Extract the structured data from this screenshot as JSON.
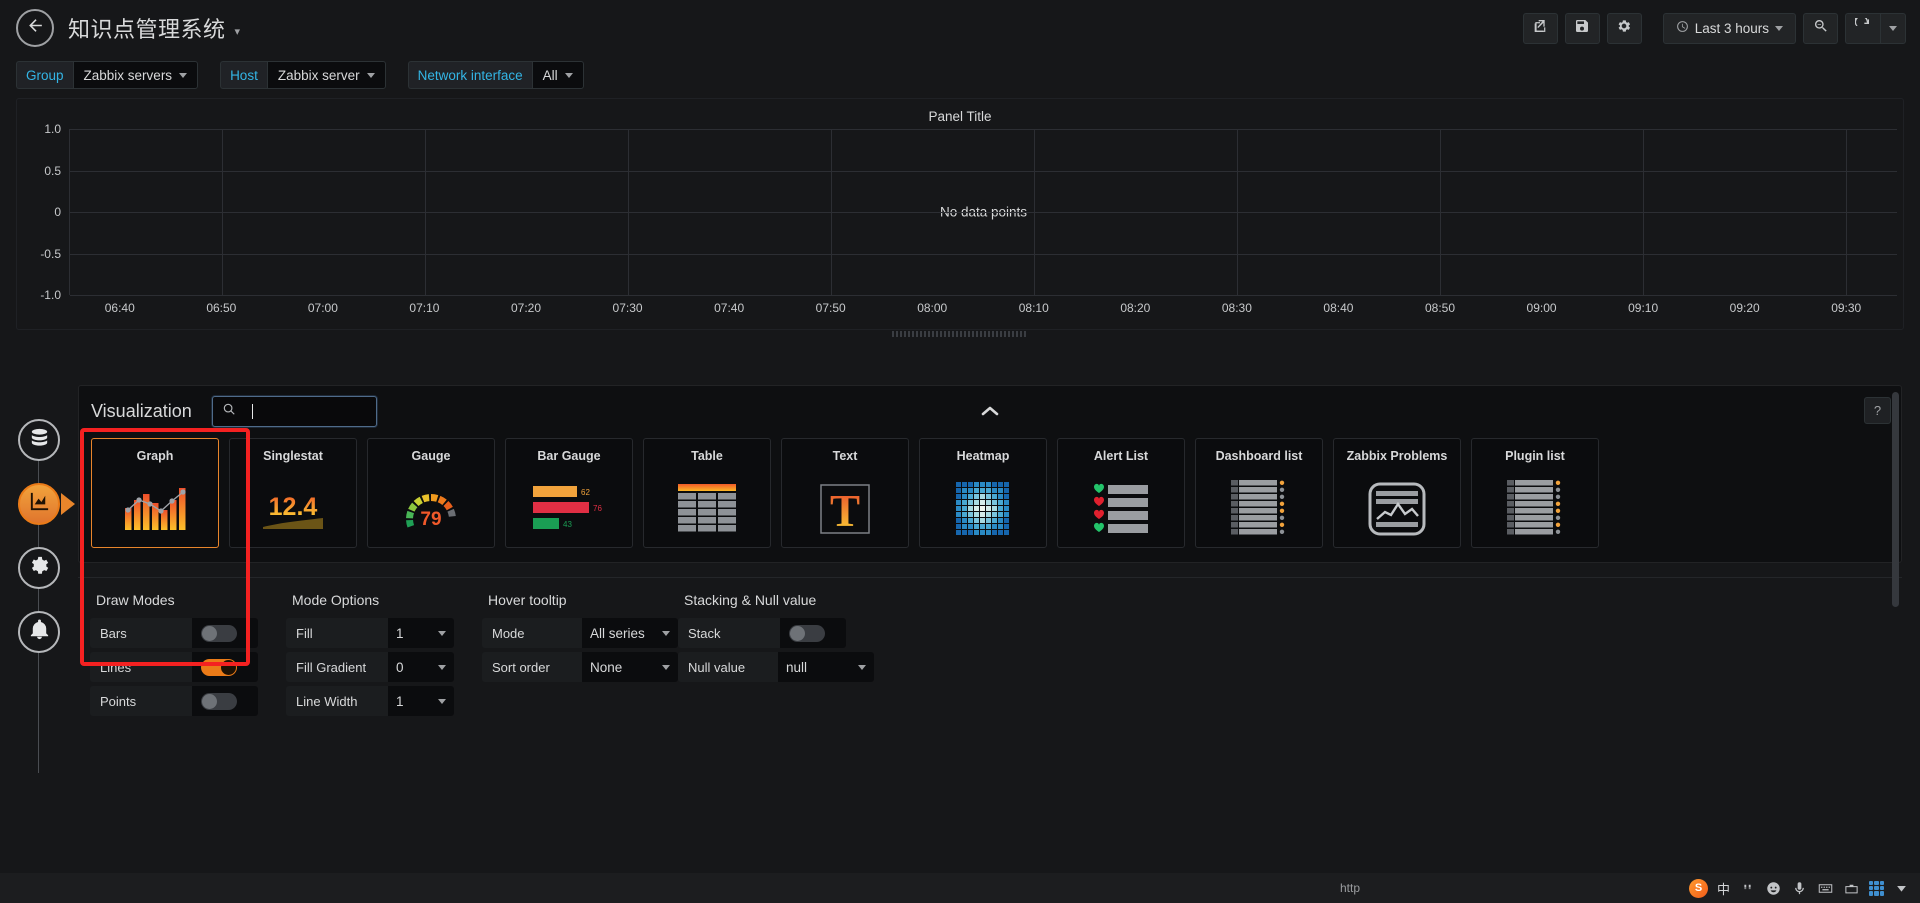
{
  "topnav": {
    "back_icon": "back-arrow-icon",
    "title": "知识点管理系统",
    "title_caret": "▾",
    "buttons": [
      {
        "name": "share-dashboard-button",
        "icon": "share-icon"
      },
      {
        "name": "save-dashboard-button",
        "icon": "save-icon"
      },
      {
        "name": "dashboard-settings-button",
        "icon": "gear-icon"
      }
    ],
    "time_picker": {
      "label": "Last 3 hours",
      "icon": "clock-icon"
    },
    "zoom_out": {
      "name": "zoom-out-button",
      "icon": "search-minus-icon"
    },
    "refresh": {
      "name": "refresh-button",
      "icon": "refresh-icon"
    },
    "refresh_interval_caret": "▾"
  },
  "submenu": {
    "variables": [
      {
        "label": "Group",
        "value": "Zabbix servers"
      },
      {
        "label": "Host",
        "value": "Zabbix server"
      },
      {
        "label": "Network interface",
        "value": "All"
      }
    ]
  },
  "panel": {
    "title": "Panel Title",
    "no_data_text": "No data points"
  },
  "chart_data": {
    "type": "line",
    "title": "Panel Title",
    "xlabel": "",
    "ylabel": "",
    "series": [],
    "values": [],
    "y_ticks": [
      "1.0",
      "0.5",
      "0",
      "-0.5",
      "-1.0"
    ],
    "ylim": [
      -1.0,
      1.0
    ],
    "x_ticks": [
      "06:40",
      "06:50",
      "07:00",
      "07:10",
      "07:20",
      "07:30",
      "07:40",
      "07:50",
      "08:00",
      "08:10",
      "08:20",
      "08:30",
      "08:40",
      "08:50",
      "09:00",
      "09:10",
      "09:20",
      "09:30"
    ],
    "grid": true,
    "legend": "none",
    "empty_message": "No data points"
  },
  "rail": {
    "items": [
      {
        "name": "sidebar-item-queries",
        "icon": "database-icon",
        "active": false
      },
      {
        "name": "sidebar-item-visualization",
        "icon": "graph-area-icon",
        "active": true
      },
      {
        "name": "sidebar-item-general",
        "icon": "gear-wrench-icon",
        "active": false
      },
      {
        "name": "sidebar-item-alert",
        "icon": "bell-icon",
        "active": false
      }
    ]
  },
  "viz_picker": {
    "title": "Visualization",
    "search_placeholder": "",
    "search_value": "",
    "search_icon": "search-icon",
    "collapse_icon": "chevron-up-icon",
    "help_label": "?",
    "cards": [
      {
        "label": "Graph",
        "icon": "graph-bars-line-icon",
        "selected": true
      },
      {
        "label": "Singlestat",
        "icon": "singlestat-icon",
        "selected": false,
        "value": "12.4"
      },
      {
        "label": "Gauge",
        "icon": "gauge-icon",
        "selected": false,
        "value": "79"
      },
      {
        "label": "Bar Gauge",
        "icon": "bar-gauge-icon",
        "selected": false,
        "values": [
          "62",
          "76",
          "43"
        ]
      },
      {
        "label": "Table",
        "icon": "table-icon",
        "selected": false
      },
      {
        "label": "Text",
        "icon": "text-t-icon",
        "selected": false,
        "value": "T"
      },
      {
        "label": "Heatmap",
        "icon": "heatmap-icon",
        "selected": false
      },
      {
        "label": "Alert List",
        "icon": "alert-list-icon",
        "selected": false
      },
      {
        "label": "Dashboard list",
        "icon": "dashboard-list-icon",
        "selected": false
      },
      {
        "label": "Zabbix Problems",
        "icon": "zabbix-problems-icon",
        "selected": false
      },
      {
        "label": "Plugin list",
        "icon": "plugin-list-icon",
        "selected": false
      }
    ]
  },
  "options": {
    "groups": [
      {
        "title": "Draw Modes",
        "rows": [
          {
            "label": "Bars",
            "control": "toggle",
            "value": "off"
          },
          {
            "label": "Lines",
            "control": "toggle",
            "value": "on"
          },
          {
            "label": "Points",
            "control": "toggle",
            "value": "off"
          }
        ]
      },
      {
        "title": "Mode Options",
        "rows": [
          {
            "label": "Fill",
            "control": "select",
            "value": "1"
          },
          {
            "label": "Fill Gradient",
            "control": "select",
            "value": "0"
          },
          {
            "label": "Line Width",
            "control": "select",
            "value": "1"
          }
        ]
      },
      {
        "title": "Hover tooltip",
        "rows": [
          {
            "label": "Mode",
            "control": "select",
            "value": "All series"
          },
          {
            "label": "Sort order",
            "control": "select",
            "value": "None"
          }
        ]
      },
      {
        "title": "Stacking & Null value",
        "rows": [
          {
            "label": "Stack",
            "control": "toggle",
            "value": "off"
          },
          {
            "label": "Null value",
            "control": "select",
            "value": "null"
          }
        ]
      }
    ]
  },
  "taskbar": {
    "url_text": "http",
    "ime_label": "中",
    "items": [
      {
        "name": "sogou-logo-icon"
      },
      {
        "name": "ime-chinese-label"
      },
      {
        "name": "ime-punctuation-icon"
      },
      {
        "name": "emoji-icon"
      },
      {
        "name": "microphone-icon"
      },
      {
        "name": "keyboard-icon"
      },
      {
        "name": "toolbox-icon"
      },
      {
        "name": "apps-grid-icon"
      },
      {
        "name": "ime-menu-icon"
      }
    ]
  },
  "colors": {
    "accent_orange": "#eb7b18",
    "link_blue": "#33b5e5",
    "annotation_red": "#f42121",
    "panel_bg": "#161719",
    "grid_line": "#2c2e33"
  }
}
